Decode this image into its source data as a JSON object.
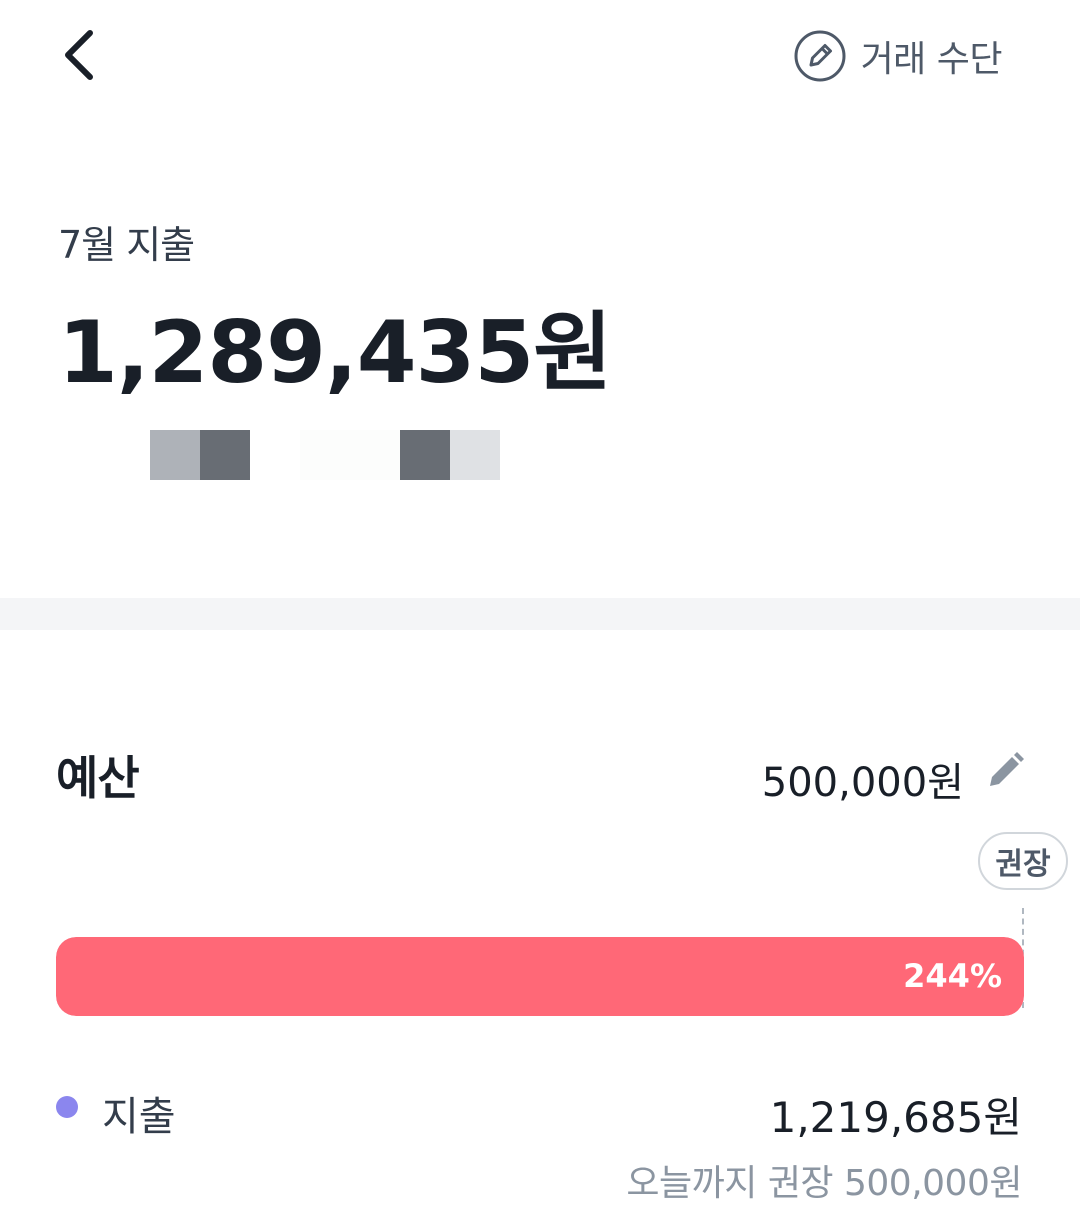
{
  "header": {
    "action_label": "거래 수단"
  },
  "summary": {
    "month_label": "7월 지출",
    "total": "1,289,435원",
    "masked_colors": [
      "#ffffff",
      "#aeb2b8",
      "#686d74",
      "#ffffff",
      "#fcfdfc",
      "#fcfdfc",
      "#686d74",
      "#dfe1e4"
    ]
  },
  "budget": {
    "title": "예산",
    "amount": "500,000원",
    "recommend_badge": "권장",
    "progress_label": "244%",
    "progress_fraction": 2.44,
    "legend_label": "지출",
    "spent_amount": "1,219,685원",
    "recommend_today": "오늘까지 권장 500,000원"
  },
  "colors": {
    "progress_fill": "#ff6877",
    "legend_dot": "#8b86ee"
  },
  "icons": {
    "back": "chevron-left-icon",
    "action": "pencil-circle-icon",
    "edit": "pencil-icon"
  }
}
